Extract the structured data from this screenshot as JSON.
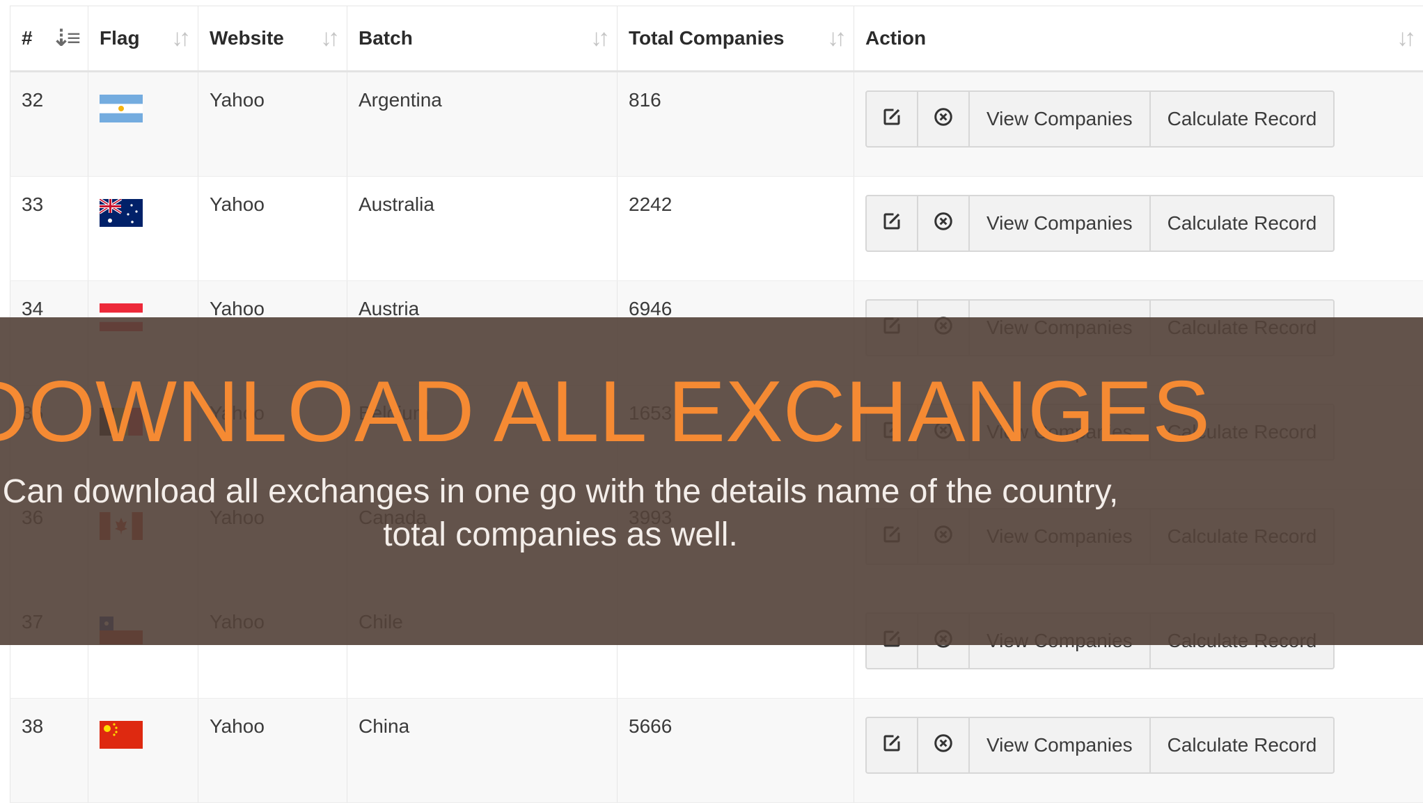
{
  "table": {
    "headers": {
      "num": "#",
      "flag": "Flag",
      "website": "Website",
      "batch": "Batch",
      "total": "Total Companies",
      "action": "Action"
    },
    "rows": [
      {
        "num": "32",
        "flag_icon": "flag-argentina-icon",
        "website": "Yahoo",
        "batch": "Argentina",
        "total": "816"
      },
      {
        "num": "33",
        "flag_icon": "flag-australia-icon",
        "website": "Yahoo",
        "batch": "Australia",
        "total": "2242"
      },
      {
        "num": "34",
        "flag_icon": "flag-austria-icon",
        "website": "Yahoo",
        "batch": "Austria",
        "total": "6946"
      },
      {
        "num": "35",
        "flag_icon": "flag-belgium-icon",
        "website": "Yahoo",
        "batch": "Belgium",
        "total": "1653"
      },
      {
        "num": "36",
        "flag_icon": "flag-canada-icon",
        "website": "Yahoo",
        "batch": "Canada",
        "total": "3993"
      },
      {
        "num": "37",
        "flag_icon": "flag-chile-icon",
        "website": "Yahoo",
        "batch": "Chile",
        "total": ""
      },
      {
        "num": "38",
        "flag_icon": "flag-china-icon",
        "website": "Yahoo",
        "batch": "China",
        "total": "5666"
      }
    ],
    "actions": {
      "edit_icon": "edit-icon",
      "delete_icon": "close-circle-icon",
      "view": "View Companies",
      "calculate": "Calculate Record"
    }
  },
  "overlay": {
    "title": "DOWNLOAD ALL EXCHANGES",
    "subtitle": "Can download all exchanges in one go with the details name of the country, total companies as well."
  },
  "colors": {
    "overlay": "#544239",
    "title": "#f58a33"
  }
}
